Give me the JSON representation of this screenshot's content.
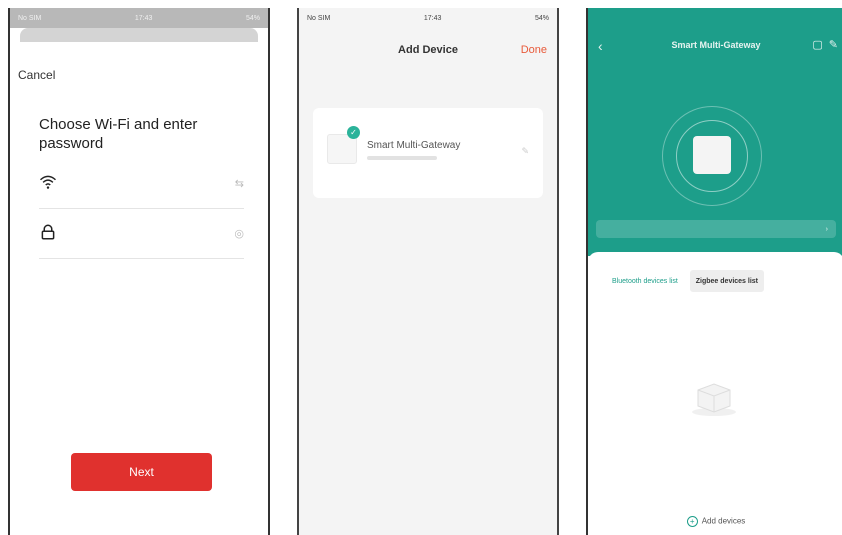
{
  "phone1": {
    "status": {
      "carrier": "No SIM",
      "time": "17:43",
      "battery": "54%"
    },
    "cancel_label": "Cancel",
    "title": "Choose Wi-Fi and enter password",
    "wifi_field": {
      "value": "",
      "icon": "wifi-icon",
      "right_icon": "switch-network-icon"
    },
    "password_field": {
      "value": "",
      "icon": "lock-icon",
      "right_icon": "eye-icon"
    },
    "next_label": "Next",
    "accent_color": "#e0312e"
  },
  "phone2": {
    "status": {
      "carrier": "No SIM",
      "time": "17:43",
      "battery": "54%"
    },
    "title": "Add Device",
    "done_label": "Done",
    "device": {
      "name": "Smart Multi-Gateway"
    }
  },
  "phone3": {
    "title": "Smart Multi-Gateway",
    "tabs": [
      "Bluetooth devices list",
      "Zigbee devices list"
    ],
    "add_device_label": "Add devices",
    "theme_color": "#1d9e8a"
  }
}
